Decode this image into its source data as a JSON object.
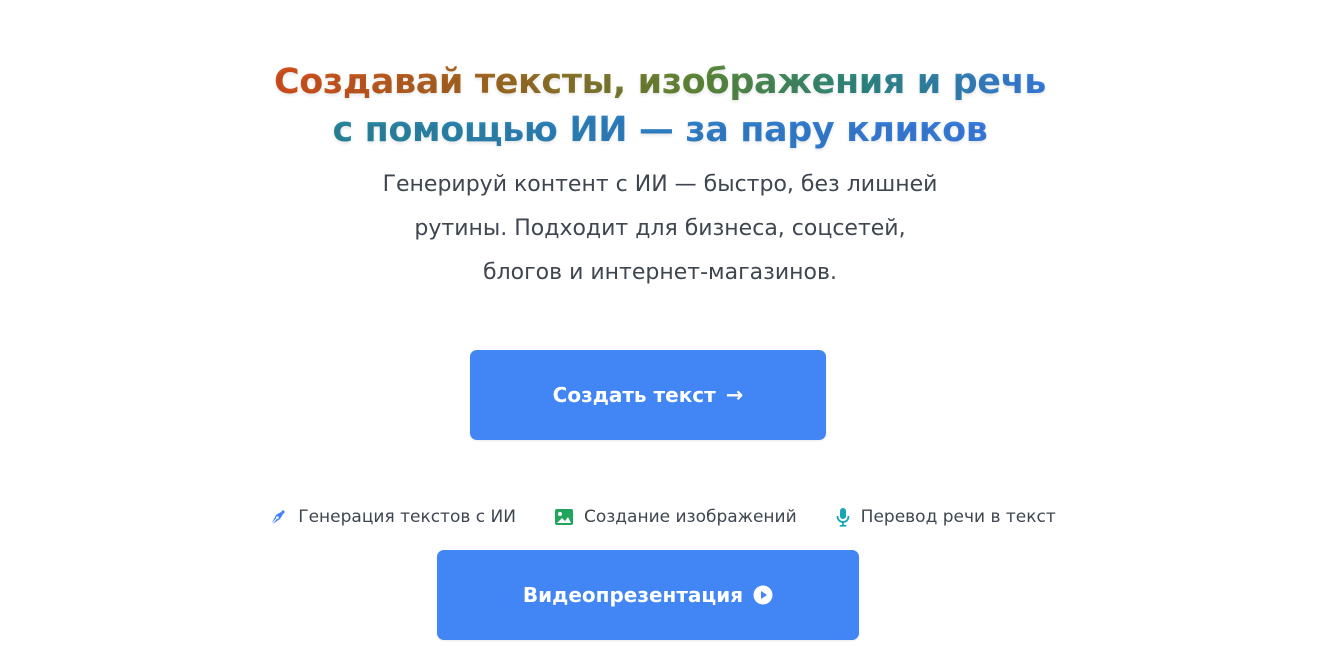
{
  "hero": {
    "title_line1": "Создавай тексты, изображения и речь",
    "title_line2": "с помощью ИИ — за пару кликов",
    "subtitle_line1": "Генерируй контент с ИИ — быстро, без лишней",
    "subtitle_line2": "рутины. Подходит для бизнеса, соцсетей,",
    "subtitle_line3": "блогов и интернет-магазинов."
  },
  "buttons": {
    "create_text_label": "Создать текст",
    "create_text_arrow": "→",
    "video_label": "Видеопрезентация"
  },
  "features": [
    {
      "icon": "pen-nib-icon",
      "label": "Генерация текстов с ИИ",
      "color": "#3b82f6"
    },
    {
      "icon": "image-icon",
      "label": "Создание изображений",
      "color": "#22a45d"
    },
    {
      "icon": "microphone-icon",
      "label": "Перевод речи в текст",
      "color": "#14a6b8"
    }
  ],
  "colors": {
    "accent": "#4285f4",
    "text": "#3e4650",
    "title_gradient_start": "#d9501e",
    "title_gradient_end": "#3a7ee8"
  }
}
